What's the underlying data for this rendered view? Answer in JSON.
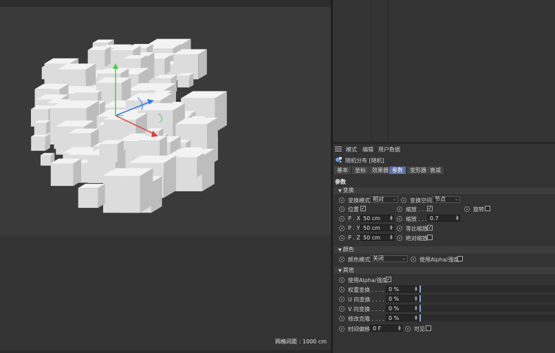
{
  "viewport": {
    "grid_label": "网格间距 : 1000 cm"
  },
  "attr": {
    "menu": [
      "模式",
      "编辑",
      "用户数据"
    ],
    "object_title": "随机分布 [随机]",
    "tabs": [
      "基本",
      "坐标",
      "效果器",
      "参数",
      "变形器",
      "衰减"
    ],
    "active_tab": "参数",
    "params_header": "参数",
    "sections": {
      "transform": "变换",
      "color": "颜色",
      "other": "其他"
    },
    "transform": {
      "mode_label": "变换模式",
      "mode_value": "相对",
      "space_label": "变换空间",
      "space_value": "节点",
      "position_label": "位置",
      "scale_label": "缩放 . . .",
      "rotate_label": "旋转",
      "px_label": "P . X",
      "px_value": "50 cm",
      "py_label": "P . Y",
      "py_value": "50 cm",
      "pz_label": "P . Z",
      "pz_value": "50 cm",
      "scale2_label": "缩放 . . .",
      "scale2_value": "0.7",
      "uniform_label": "等比缩放",
      "absolute_label": "绝对缩放"
    },
    "color": {
      "mode_label": "颜色模式",
      "mode_value": "关闭",
      "alpha_label": "使用Alpha/强度"
    },
    "other": {
      "alpha_label": "使用Alpha/强度",
      "weight_label": "权重变换 . . . . .",
      "weight_value": "0 %",
      "u_label": "U 向变换 . . . . .",
      "u_value": "0 %",
      "v_label": "V 向变换 . . . . .",
      "v_value": "0 %",
      "clone_label": "修改克隆 . . . . .",
      "clone_value": "0 %",
      "time_label": "时间偏移",
      "time_value": "0 F",
      "visible_label": "可见"
    }
  }
}
